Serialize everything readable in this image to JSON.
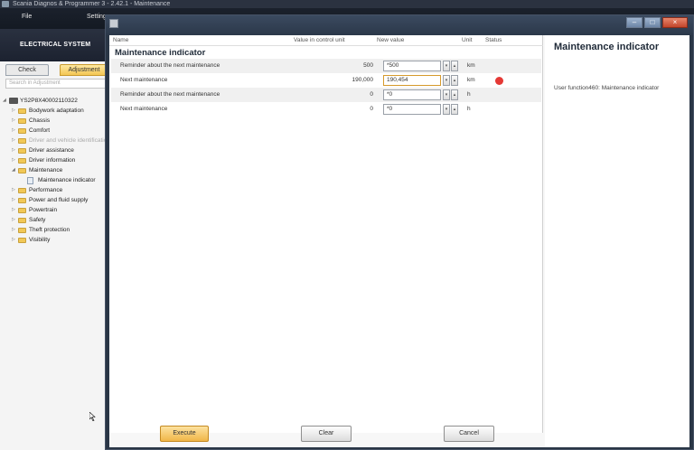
{
  "app": {
    "title": "Scania Diagnos & Programmer 3 - 2.42.1 - Maintenance",
    "menu": [
      "File",
      "Settings"
    ],
    "header": "ELECTRICAL SYSTEM"
  },
  "left": {
    "tabs": [
      "Check",
      "Adjustment"
    ],
    "search_placeholder": "Search in Adjustment",
    "tree": [
      {
        "label": "YS2P8X40002110322",
        "type": "vehicle",
        "level": 0,
        "expanded": true
      },
      {
        "label": "Bodywork adaptation",
        "type": "folder",
        "level": 1
      },
      {
        "label": "Chassis",
        "type": "folder",
        "level": 1
      },
      {
        "label": "Comfort",
        "type": "folder",
        "level": 1
      },
      {
        "label": "Driver and vehicle identification",
        "type": "folder",
        "level": 1,
        "disabled": true
      },
      {
        "label": "Driver assistance",
        "type": "folder",
        "level": 1
      },
      {
        "label": "Driver information",
        "type": "folder",
        "level": 1
      },
      {
        "label": "Maintenance",
        "type": "folder",
        "level": 1,
        "expanded": true
      },
      {
        "label": "Maintenance indicator",
        "type": "leaf",
        "level": 2
      },
      {
        "label": "Performance",
        "type": "folder",
        "level": 1
      },
      {
        "label": "Power and fluid supply",
        "type": "folder",
        "level": 1
      },
      {
        "label": "Powertrain",
        "type": "folder",
        "level": 1
      },
      {
        "label": "Safety",
        "type": "folder",
        "level": 1
      },
      {
        "label": "Theft protection",
        "type": "folder",
        "level": 1
      },
      {
        "label": "Visibility",
        "type": "folder",
        "level": 1
      }
    ]
  },
  "dialog": {
    "columns": {
      "name": "Name",
      "value_cu": "Value in control unit",
      "new_value": "New value",
      "unit": "Unit",
      "status": "Status"
    },
    "group_title": "Maintenance indicator",
    "rows": [
      {
        "name": "Reminder about the next maintenance",
        "current": "500",
        "new": "*500",
        "unit": "km",
        "status": ""
      },
      {
        "name": "Next maintenance",
        "current": "190,000",
        "new": "190,454",
        "unit": "km",
        "status": "error"
      },
      {
        "name": "Reminder about the next maintenance",
        "current": "0",
        "new": "*0",
        "unit": "h",
        "status": ""
      },
      {
        "name": "Next maintenance",
        "current": "0",
        "new": "*0",
        "unit": "h",
        "status": ""
      }
    ],
    "info_title": "Maintenance indicator",
    "info_text": "User function460: Maintenance indicator",
    "buttons": {
      "execute": "Execute",
      "clear": "Clear",
      "cancel": "Cancel"
    },
    "colors": {
      "status_error": "#e53935",
      "accent": "#f0b648"
    }
  }
}
